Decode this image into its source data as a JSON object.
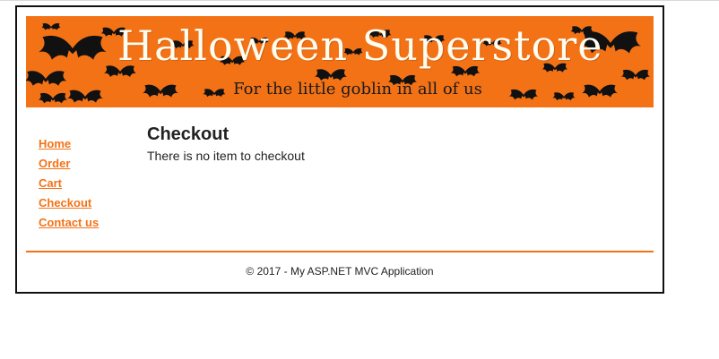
{
  "banner": {
    "title": "Halloween Superstore",
    "tagline": "For the little goblin in all of us",
    "background_color": "#f47216",
    "decoration_icon": "bat-icon"
  },
  "nav": {
    "items": [
      {
        "label": "Home"
      },
      {
        "label": "Order"
      },
      {
        "label": "Cart"
      },
      {
        "label": "Checkout"
      },
      {
        "label": "Contact us"
      }
    ],
    "link_color": "#f47216"
  },
  "main": {
    "heading": "Checkout",
    "message": "There is no item to checkout"
  },
  "footer": {
    "text": "© 2017 - My ASP.NET MVC Application",
    "divider_color": "#f47216"
  }
}
